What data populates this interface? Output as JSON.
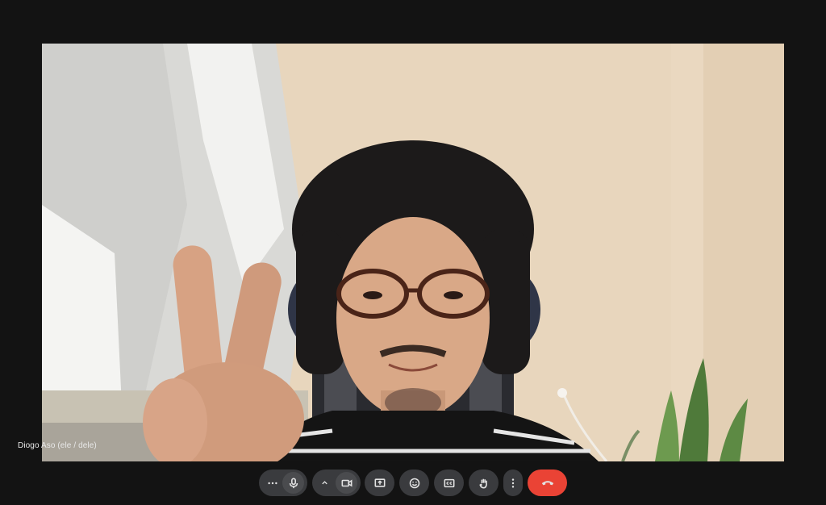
{
  "participant": {
    "name": "Diogo Aso (ele / dele)"
  },
  "controls": [
    {
      "id": "more-audio",
      "icon": "ellipsis-icon"
    },
    {
      "id": "mic",
      "icon": "microphone-icon"
    },
    {
      "id": "camera-options",
      "icon": "chevron-up-icon"
    },
    {
      "id": "camera",
      "icon": "video-camera-icon"
    },
    {
      "id": "present",
      "icon": "present-screen-icon"
    },
    {
      "id": "reactions",
      "icon": "emoji-icon"
    },
    {
      "id": "captions",
      "icon": "captions-icon"
    },
    {
      "id": "raise-hand",
      "icon": "hand-icon"
    },
    {
      "id": "more-options",
      "icon": "vertical-dots-icon"
    },
    {
      "id": "leave-call",
      "icon": "hang-up-icon"
    }
  ],
  "colors": {
    "background": "#131313",
    "control": "#3a3b3e",
    "end_call": "#ea4335"
  }
}
